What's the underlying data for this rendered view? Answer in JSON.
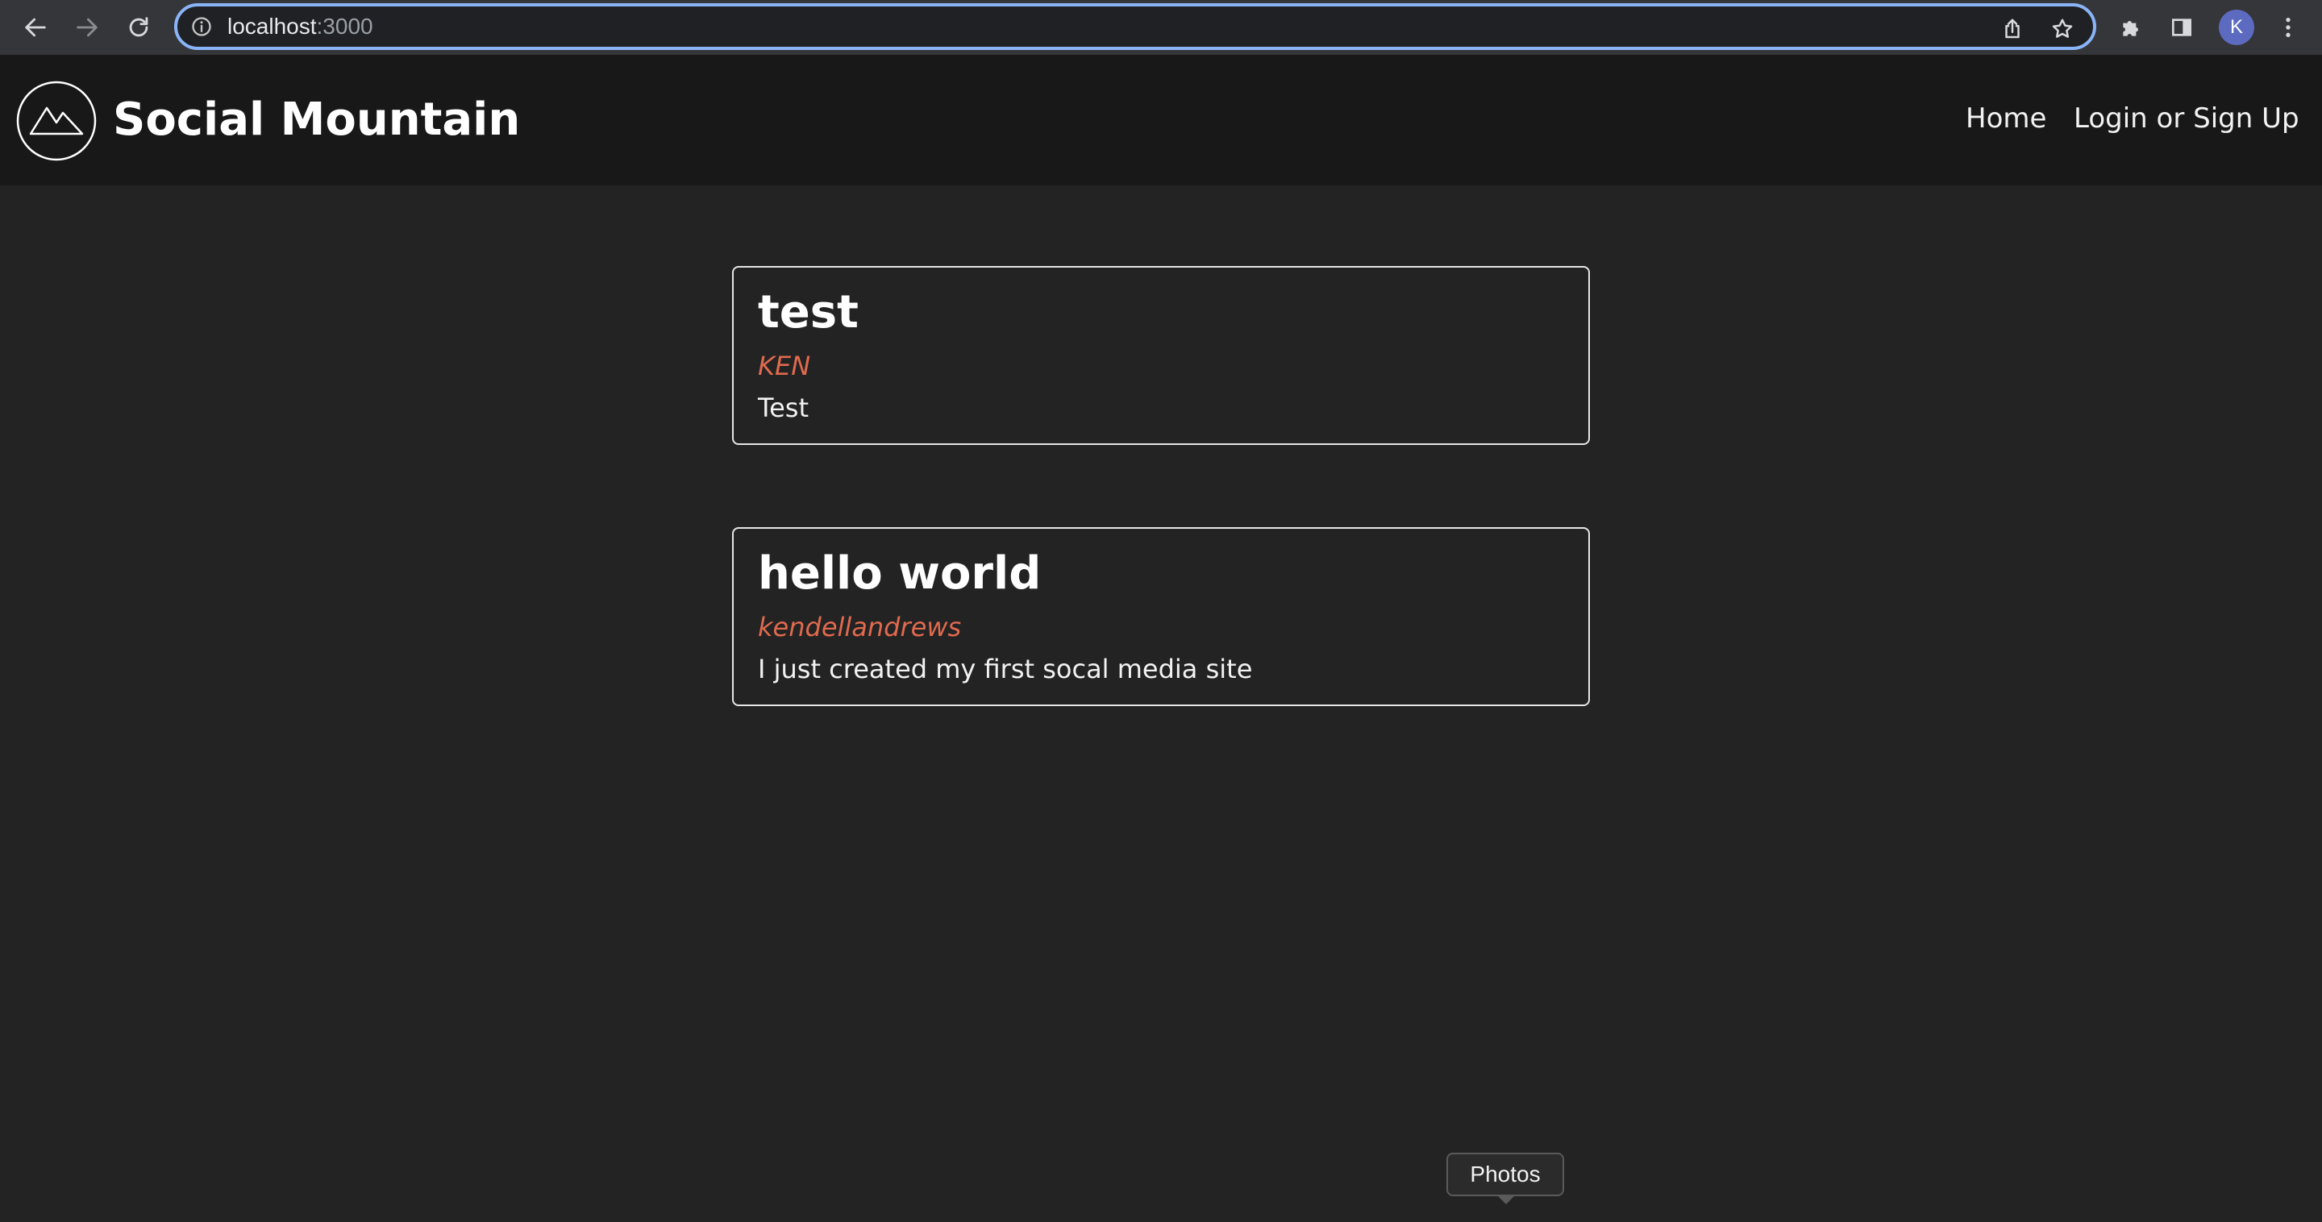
{
  "browser": {
    "url_host": "localhost",
    "url_port": ":3000",
    "profile_initial": "K",
    "icons": {
      "back": "back-arrow-icon",
      "forward": "forward-arrow-icon",
      "reload": "reload-icon",
      "site_info": "info-icon",
      "share": "share-icon",
      "bookmark": "star-icon",
      "extensions": "puzzle-icon",
      "side_panel": "side-panel-icon",
      "menu": "kebab-menu-icon"
    },
    "accent_color": "#8ab4f8"
  },
  "site": {
    "title": "Social Mountain",
    "logo_icon": "mountain-logo-icon",
    "nav": {
      "home": "Home",
      "login": "Login or Sign Up"
    }
  },
  "posts": [
    {
      "title": "test",
      "author": "KEN",
      "body": "Test"
    },
    {
      "title": "hello world",
      "author": "kendellandrews",
      "body": "I just created my first socal media site"
    }
  ],
  "colors": {
    "author": "#e06a4e",
    "background": "#232323",
    "header": "#181818"
  },
  "tooltip": {
    "text": "Photos"
  }
}
